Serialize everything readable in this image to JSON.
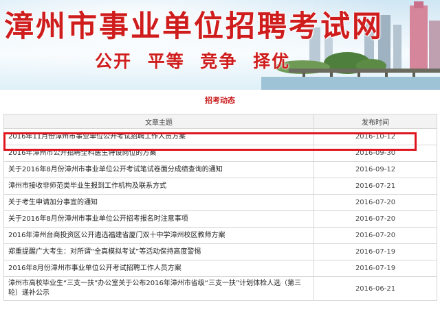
{
  "header": {
    "site_title": "漳州市事业单位招聘考试网",
    "slogan": "公开  平等  竞争  择优"
  },
  "section": {
    "heading": "招考动态"
  },
  "table": {
    "columns": [
      "文章主题",
      "发布时间"
    ],
    "rows": [
      {
        "title": "2016年11月份漳州市事业单位公开考试招聘工作人员方案",
        "date": "2016-10-12",
        "highlighted": true
      },
      {
        "title": "2016年漳州市公开招聘全科医生特设岗位的方案",
        "date": "2016-09-30"
      },
      {
        "title": "关于2016年8月份漳州市事业单位公开考试笔试卷面分成绩查询的通知",
        "date": "2016-09-12"
      },
      {
        "title": "漳州市接收非师范类毕业生报到工作机构及联系方式",
        "date": "2016-07-21"
      },
      {
        "title": "关于考生申请加分事宜的通知",
        "date": "2016-07-20"
      },
      {
        "title": "关于2016年8月份漳州市事业单位公开招考报名时注意事项",
        "date": "2016-07-20"
      },
      {
        "title": "2016年漳州台商投资区公开遴选福建省厦门双十中学漳州校区教师方案",
        "date": "2016-07-20"
      },
      {
        "title": "郑重提醒广大考生：对所谓“全真模拟考试”等活动保持高度警惕",
        "date": "2016-07-19"
      },
      {
        "title": "2016年8月份漳州市事业单位公开考试招聘工作人员方案",
        "date": "2016-07-19"
      },
      {
        "title": "漳州市高校毕业生“三支一扶”办公室关于公布2016年漳州市省级“三支一扶”计划体检人选（第三轮）递补公示",
        "date": "2016-06-21"
      }
    ]
  },
  "colors": {
    "brand_red": "#cf1c1c",
    "highlight_border": "#e0141e",
    "grid": "#d6d6d6"
  }
}
